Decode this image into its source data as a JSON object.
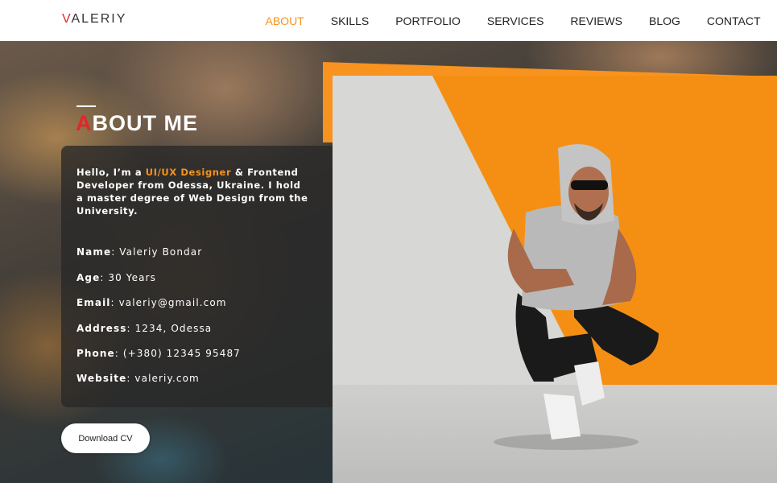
{
  "logo": {
    "first": "V",
    "rest": "ALERIY"
  },
  "nav": [
    {
      "label": "ABOUT",
      "active": true
    },
    {
      "label": "SKILLS"
    },
    {
      "label": "PORTFOLIO"
    },
    {
      "label": "SERVICES"
    },
    {
      "label": "REVIEWS"
    },
    {
      "label": "BLOG"
    },
    {
      "label": "CONTACT"
    }
  ],
  "section": {
    "title_first": "A",
    "title_rest": "BOUT ME"
  },
  "intro": {
    "prefix": "Hello, I’m a ",
    "highlight": "UI/UX Designer",
    "suffix": " & Frontend Developer from Odessa, Ukraine. I hold a master degree of Web Design from the University."
  },
  "info": [
    {
      "key": "Name",
      "value": ": Valeriy Bondar"
    },
    {
      "key": "Age",
      "value": ": 30 Years"
    },
    {
      "key": "Email",
      "value": ": valeriy@gmail.com"
    },
    {
      "key": "Address",
      "value": ": 1234, Odessa"
    },
    {
      "key": "Phone",
      "value": ": (+380) 12345 95487"
    },
    {
      "key": "Website",
      "value": ": valeriy.com"
    }
  ],
  "download_label": "Download CV",
  "colors": {
    "accent": "#f7921e",
    "logo_red": "#e3262b",
    "photo_orange": "#f58f13"
  }
}
